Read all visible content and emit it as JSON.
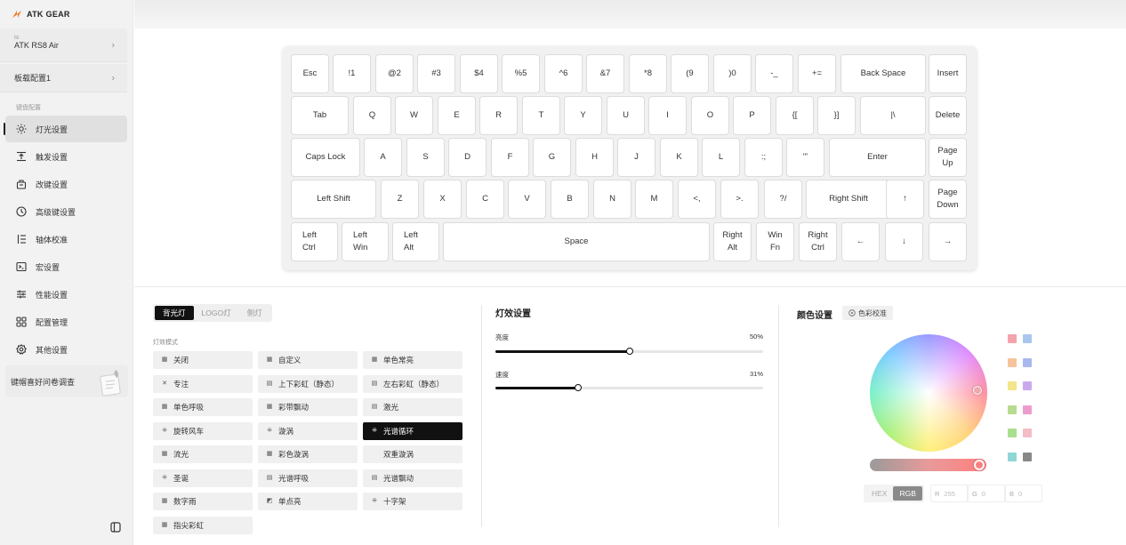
{
  "app": {
    "logo_text": "ATK GEAR"
  },
  "sidebar": {
    "device_label": "Ⅰ≡",
    "device_name": "ATK RS8 Air",
    "profile": "板载配置1",
    "section_label": "键盘配置",
    "items": [
      {
        "label": "灯光设置",
        "icon": "sun-icon",
        "active": true
      },
      {
        "label": "触发设置",
        "icon": "trigger-icon"
      },
      {
        "label": "改键设置",
        "icon": "keyboard-remap-icon"
      },
      {
        "label": "高级键设置",
        "icon": "advanced-key-icon"
      },
      {
        "label": "轴体校准",
        "icon": "calibration-icon"
      },
      {
        "label": "宏设置",
        "icon": "macro-icon"
      },
      {
        "label": "性能设置",
        "icon": "sliders-icon"
      },
      {
        "label": "配置管理",
        "icon": "grid-icon"
      },
      {
        "label": "其他设置",
        "icon": "gear-icon"
      }
    ],
    "survey": "键帽喜好问卷调查"
  },
  "keyboard": {
    "rows": [
      [
        "Esc",
        "!1",
        "@2",
        "#3",
        "$4",
        "%5",
        "^6",
        "&7",
        "*8",
        "(9",
        ")0",
        "-_",
        "+=",
        "Back Space",
        "Insert"
      ],
      [
        "Tab",
        "Q",
        "W",
        "E",
        "R",
        "T",
        "Y",
        "U",
        "I",
        "O",
        "P",
        "{[",
        "}]",
        "|\\",
        "Delete"
      ],
      [
        "Caps Lock",
        "A",
        "S",
        "D",
        "F",
        "G",
        "H",
        "J",
        "K",
        "L",
        ":;",
        "\"'",
        "Enter",
        "Page\nUp"
      ],
      [
        "Left Shift",
        "Z",
        "X",
        "C",
        "V",
        "B",
        "N",
        "M",
        "<,",
        ">.",
        "?/",
        "Right Shift",
        "↑",
        "Page\nDown"
      ],
      [
        "Left\nCtrl",
        "Left\nWin",
        "Left\nAlt",
        "Space",
        "Right\nAlt",
        "Win\nFn",
        "Right\nCtrl",
        "←",
        "↓",
        "→"
      ]
    ]
  },
  "lighting": {
    "tabs": [
      "背光灯",
      "LOGO灯",
      "侧灯"
    ],
    "active_tab": 0,
    "mode_label": "灯效模式",
    "effects": [
      "关闭",
      "自定义",
      "单色常亮",
      "专注",
      "上下彩虹（静态）",
      "左右彩虹（静态）",
      "单色呼吸",
      "彩带飘动",
      "激光",
      "旋转风车",
      "漩涡",
      "光谱循环",
      "流光",
      "彩色漩涡",
      "双重漩涡",
      "圣诞",
      "光谱呼吸",
      "光谱飘动",
      "数字雨",
      "单点亮",
      "十字架",
      "指尖彩虹"
    ],
    "active_effect": "光谱循环"
  },
  "effect_settings": {
    "title": "灯效设置",
    "brightness": {
      "label": "亮度",
      "value_text": "50%",
      "value": 0.5
    },
    "speed": {
      "label": "速度",
      "value_text": "31%",
      "value": 0.31
    }
  },
  "color_settings": {
    "title": "颜色设置",
    "calibrate_button": "色彩校准",
    "swatches": [
      "#f4a3ad",
      "#a9c6ee",
      "#f6c39c",
      "#a9b8ee",
      "#f4e48a",
      "#c9a9ee",
      "#b8dc8f",
      "#ee9ccd",
      "#a9e08f",
      "#f4bcc6",
      "#8fd6d6",
      "#888888"
    ],
    "modes": [
      "HEX",
      "RGB"
    ],
    "active_mode": "RGB",
    "r_label": "R",
    "r_value": "255",
    "g_label": "G",
    "g_value": "0",
    "b_label": "B",
    "b_value": "0"
  }
}
